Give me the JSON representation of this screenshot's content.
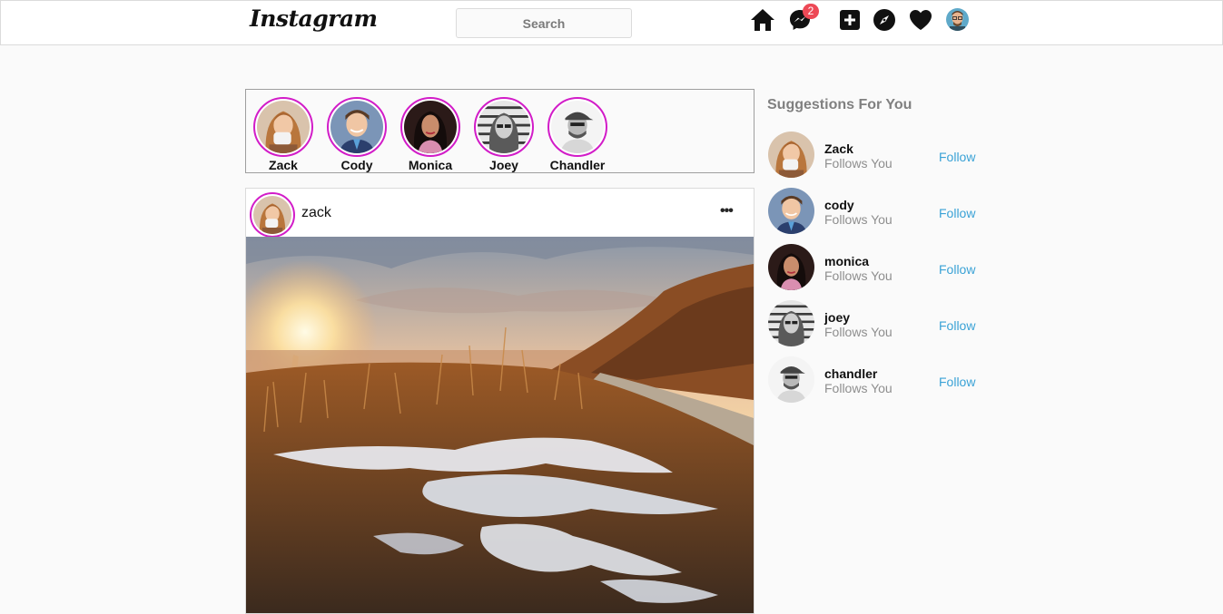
{
  "header": {
    "logo": "Instagram",
    "search": {
      "placeholder": "Search"
    },
    "message_badge": "2",
    "accent_color": "#ed4956",
    "icons": [
      "home-icon",
      "messenger-icon",
      "new-post-icon",
      "explore-icon",
      "heart-icon",
      "profile-avatar"
    ]
  },
  "stories": [
    {
      "name": "Zack"
    },
    {
      "name": "Cody"
    },
    {
      "name": "Monica"
    },
    {
      "name": "Joey"
    },
    {
      "name": "Chandler"
    }
  ],
  "post": {
    "username": "zack",
    "more_label": "•••"
  },
  "suggestions": {
    "title": "Suggestions For You",
    "items": [
      {
        "name": "Zack",
        "subtitle": "Follows You",
        "action": "Follow"
      },
      {
        "name": "cody",
        "subtitle": "Follows You",
        "action": "Follow"
      },
      {
        "name": "monica",
        "subtitle": "Follows You",
        "action": "Follow"
      },
      {
        "name": "joey",
        "subtitle": "Follows You",
        "action": "Follow"
      },
      {
        "name": "chandler",
        "subtitle": "Follows You",
        "action": "Follow"
      }
    ]
  },
  "colors": {
    "story_ring": "#d21cc8",
    "follow_link": "#3aa2d6"
  }
}
